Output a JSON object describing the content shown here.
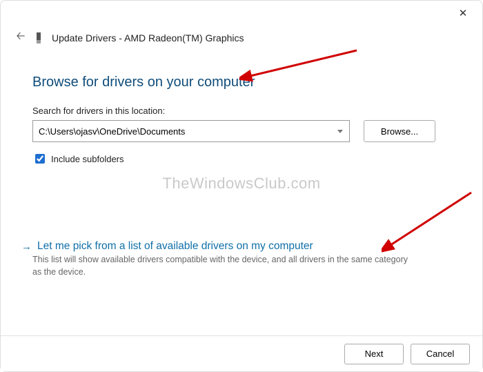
{
  "window": {
    "title": "Update Drivers - AMD Radeon(TM) Graphics"
  },
  "heading": "Browse for drivers on your computer",
  "search": {
    "label": "Search for drivers in this location:",
    "path": "C:\\Users\\ojasv\\OneDrive\\Documents",
    "browse_label": "Browse..."
  },
  "include_subfolders": {
    "label": "Include subfolders",
    "checked": true
  },
  "watermark": "TheWindowsClub.com",
  "pick": {
    "title": "Let me pick from a list of available drivers on my computer",
    "description": "This list will show available drivers compatible with the device, and all drivers in the same category as the device."
  },
  "footer": {
    "next": "Next",
    "cancel": "Cancel"
  }
}
